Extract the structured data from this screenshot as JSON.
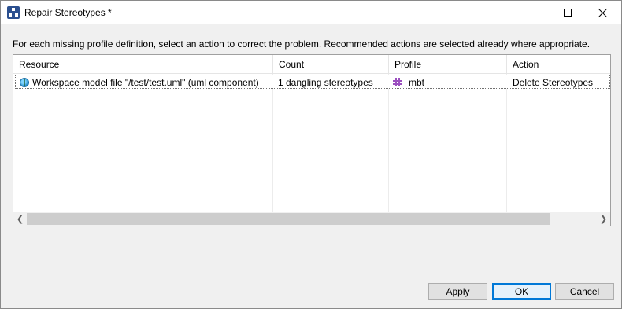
{
  "window": {
    "title": "Repair Stereotypes *"
  },
  "instruction": "For each missing profile definition, select an action to correct the problem. Recommended actions are selected already where appropriate.",
  "table": {
    "columns": [
      "Resource",
      "Count",
      "Profile",
      "Action"
    ],
    "rows": [
      {
        "resource": "Workspace model file \"/test/test.uml\" (uml component)",
        "count": "1 dangling stereotypes",
        "profile": "mbt",
        "action": "Delete Stereotypes",
        "resource_icon": "globe-icon",
        "profile_icon": "profile-icon"
      }
    ]
  },
  "buttons": {
    "apply": "Apply",
    "ok": "OK",
    "cancel": "Cancel"
  },
  "colors": {
    "accent": "#0078d7",
    "profile_icon": "#9b4fbf"
  }
}
